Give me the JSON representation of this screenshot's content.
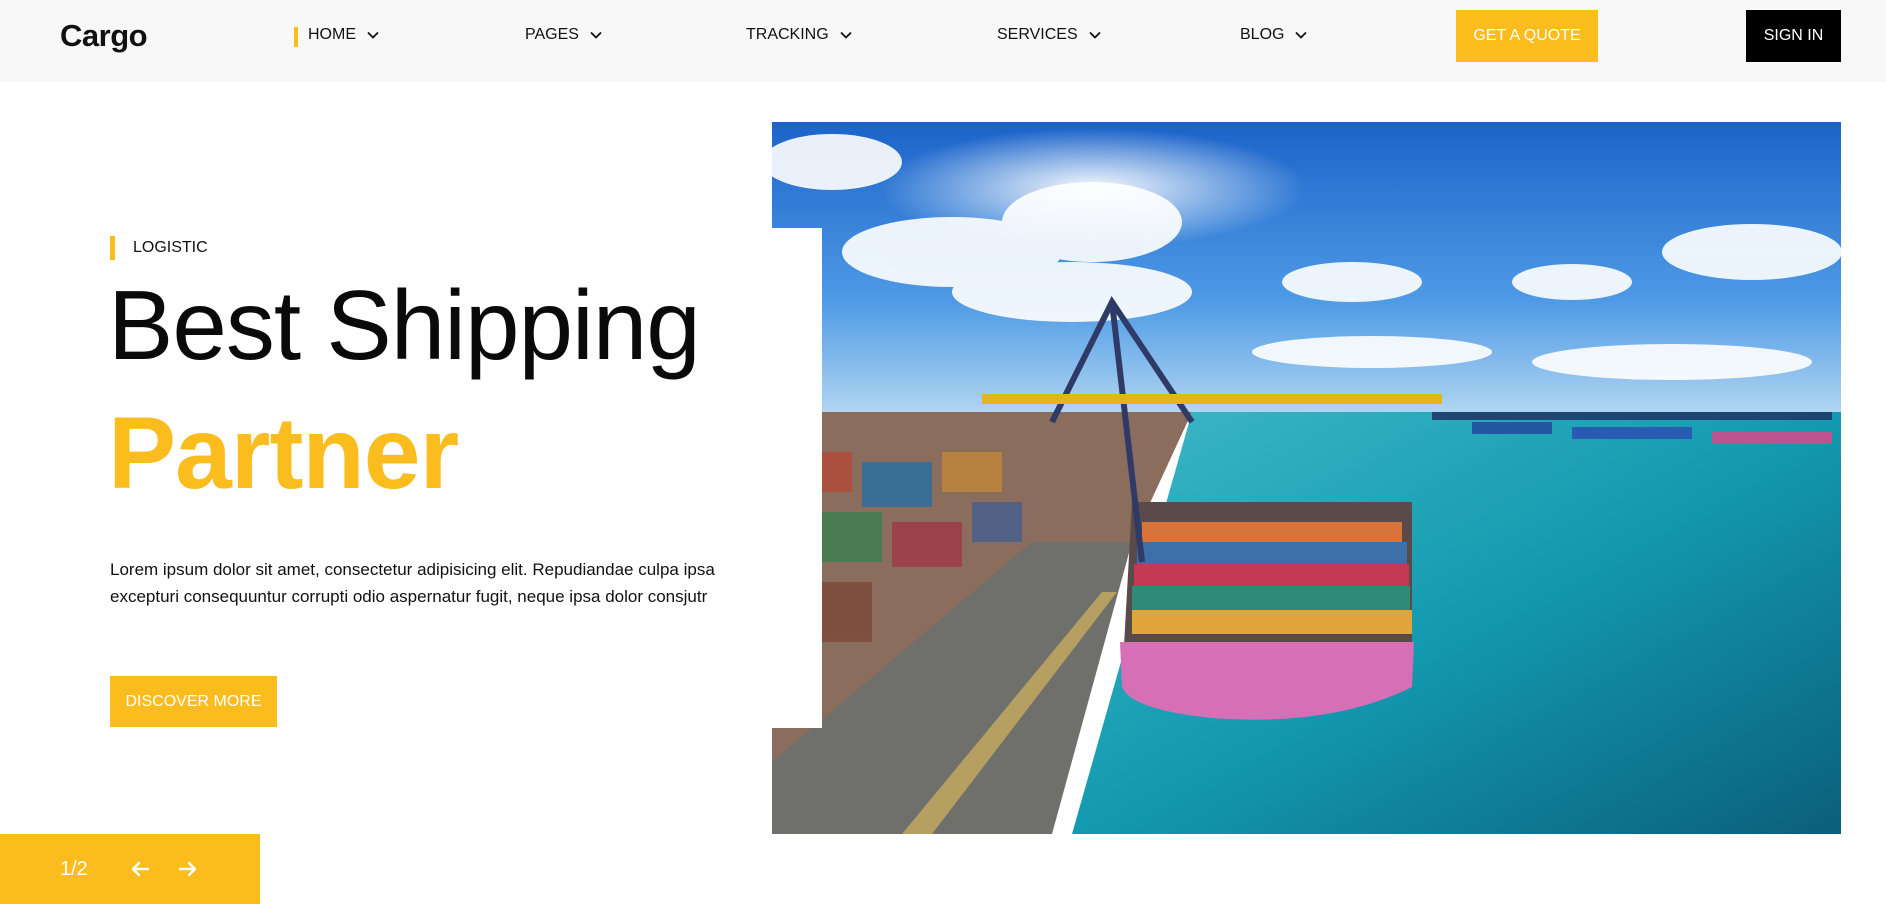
{
  "header": {
    "logo": "Cargo",
    "nav": [
      {
        "label": "HOME",
        "active": true
      },
      {
        "label": "PAGES",
        "active": false
      },
      {
        "label": "TRACKING",
        "active": false
      },
      {
        "label": "SERVICES",
        "active": false
      },
      {
        "label": "BLOG",
        "active": false
      }
    ],
    "quote_label": "GET A QUOTE",
    "signin_label": "SIGN IN"
  },
  "hero": {
    "eyebrow": "LOGISTIC",
    "title_line1": "Best Shipping",
    "title_line2": "Partner",
    "description": "Lorem ipsum dolor sit amet, consectetur adipisicing elit. Repudiandae culpa ipsa excepturi consequuntur corrupti odio aspernatur fugit, neque ipsa dolor consjutr",
    "cta_label": "DISCOVER MORE",
    "image_subject": "container-ship-port-photo"
  },
  "slider": {
    "counter": "1/2",
    "prev_icon": "arrow-left-icon",
    "next_icon": "arrow-right-icon"
  },
  "colors": {
    "accent": "#fbbc1e",
    "header_bg": "#f8f8f8",
    "dark": "#000000"
  }
}
